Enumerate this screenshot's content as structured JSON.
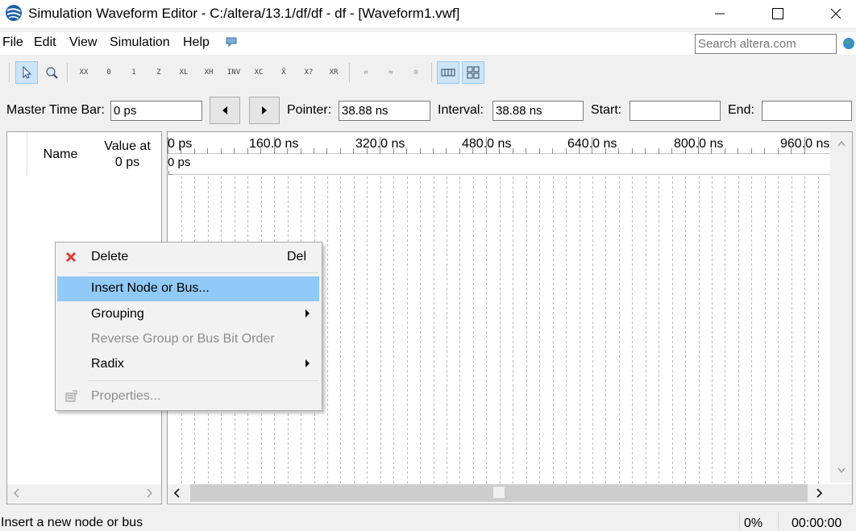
{
  "window": {
    "title": "Simulation Waveform Editor - C:/altera/13.1/df/df - df - [Waveform1.vwf]"
  },
  "menu": {
    "items": [
      "File",
      "Edit",
      "View",
      "Simulation",
      "Help"
    ],
    "search_placeholder": "Search altera.com"
  },
  "toolbar": {
    "buttons": [
      {
        "icon": "selection-tool-icon",
        "active": true
      },
      {
        "icon": "zoom-tool-icon"
      },
      {
        "icon": "force-unknown-icon"
      },
      {
        "icon": "force-low-icon"
      },
      {
        "icon": "force-high-icon"
      },
      {
        "icon": "force-high-impedance-icon"
      },
      {
        "icon": "force-weak-low-icon"
      },
      {
        "icon": "force-weak-high-icon"
      },
      {
        "icon": "invert-icon"
      },
      {
        "icon": "count-value-icon"
      },
      {
        "icon": "overwrite-clock-icon"
      },
      {
        "icon": "arbitrary-value-icon"
      },
      {
        "icon": "random-value-icon"
      },
      {
        "icon": "run-functional-simulation-icon"
      },
      {
        "icon": "run-timing-simulation-icon"
      },
      {
        "icon": "generate-netlist-icon"
      },
      {
        "icon": "snap-to-grid-icon",
        "active": true
      },
      {
        "icon": "waveform-grid-icon",
        "active": true
      }
    ]
  },
  "timebar": {
    "master_label": "Master Time Bar:",
    "master_value": "0 ps",
    "pointer_label": "Pointer:",
    "pointer_value": "38.88 ns",
    "interval_label": "Interval:",
    "interval_value": "38.88 ns",
    "start_label": "Start:",
    "start_value": "",
    "end_label": "End:",
    "end_value": ""
  },
  "node_list": {
    "name_header": "Name",
    "value_header_line1": "Value at",
    "value_header_line2": "0 ps"
  },
  "waveform": {
    "ticks": [
      "0 ps",
      "160.0 ns",
      "320.0 ns",
      "480.0 ns",
      "640.0 ns",
      "800.0 ns",
      "960.0 ns"
    ],
    "cursor_label": "0 ps"
  },
  "context_menu": {
    "delete_label": "Delete",
    "delete_shortcut": "Del",
    "insert_label": "Insert Node or Bus...",
    "grouping_label": "Grouping",
    "reverse_label": "Reverse Group or Bus Bit Order",
    "radix_label": "Radix",
    "properties_label": "Properties..."
  },
  "status": {
    "message": "Insert a new node or bus",
    "progress": "0%",
    "elapsed": "00:00:00"
  }
}
